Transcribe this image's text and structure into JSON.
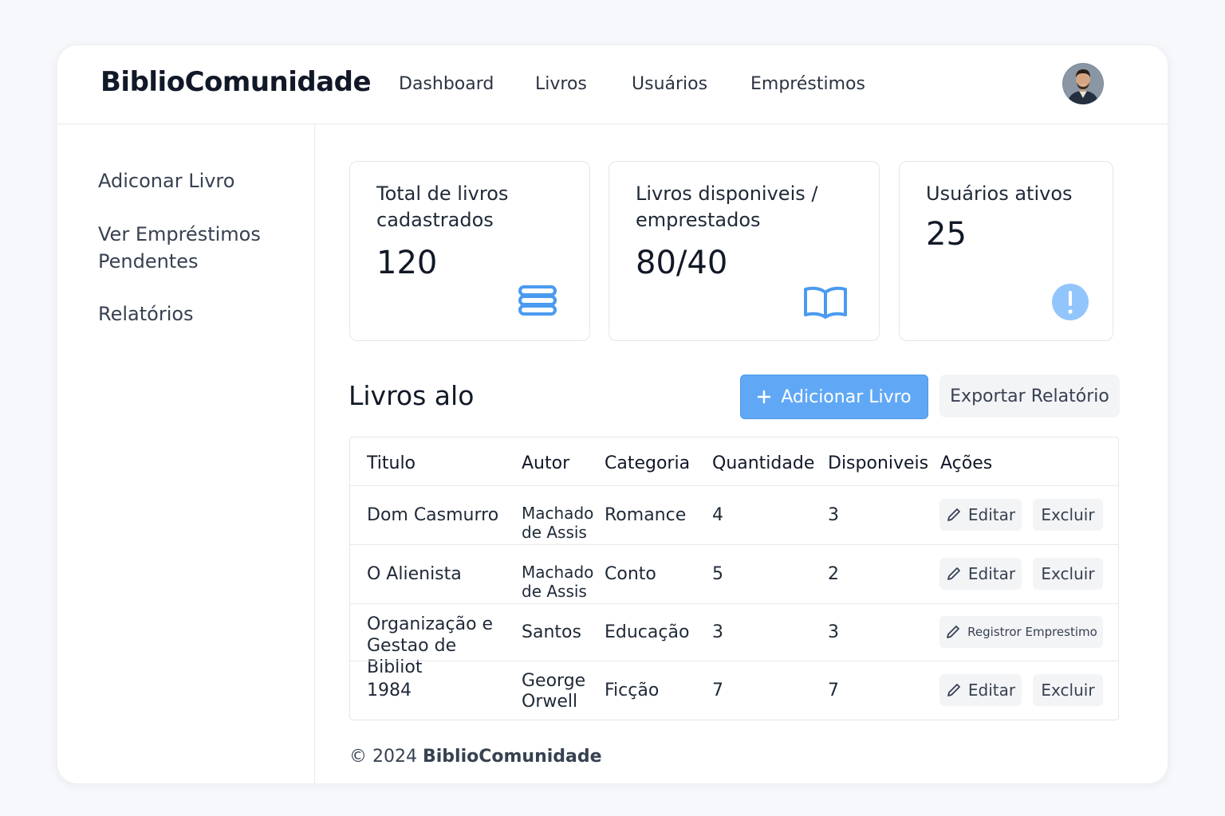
{
  "header": {
    "brand": "BiblioComunidade",
    "nav": [
      "Dashboard",
      "Livros",
      "Usuários",
      "Empréstimos"
    ]
  },
  "sidebar": {
    "items": [
      "Adiconar Livro",
      "Ver Empréstimos Pendentes",
      "Relatórios"
    ]
  },
  "stats": [
    {
      "title": "Total de livros cadastrados",
      "value": "120",
      "icon": "stack-icon"
    },
    {
      "title": "Livros disponiveis / emprestados",
      "value": "80/40",
      "icon": "open-book-icon"
    },
    {
      "title": "Usuários ativos",
      "value": "25",
      "icon": "alert-icon"
    }
  ],
  "section": {
    "title": "Livros alo",
    "add_label": "Adicionar Livro",
    "export_label": "Exportar Relatório"
  },
  "table": {
    "columns": [
      "Titulo",
      "Autor",
      "Categoria",
      "Quantidade",
      "Disponiveis",
      "Ações"
    ],
    "rows": [
      {
        "title": "Dom Casmurro",
        "author": "Machado de Assis",
        "category": "Romance",
        "quantity": "4",
        "available": "3",
        "actions": [
          "Editar",
          "Excluir"
        ]
      },
      {
        "title": "O Alienista",
        "author": "Machado de Assis",
        "category": "Conto",
        "quantity": "5",
        "available": "2",
        "actions": [
          "Editar",
          "Excluir"
        ]
      },
      {
        "title": "Organização e Gestao de Bibliot",
        "author": "Santos",
        "category": "Educação",
        "quantity": "3",
        "available": "3",
        "actions": [
          "Registror Emprestimo"
        ]
      },
      {
        "title": "1984",
        "author": "George Orwell",
        "category": "Ficção",
        "quantity": "7",
        "available": "7",
        "actions": [
          "Editar",
          "Excluir"
        ]
      }
    ]
  },
  "footer": {
    "copyright": "© 2024",
    "brand": "BiblioComunidade"
  },
  "colors": {
    "accent": "#60a8f5",
    "icon_blue": "#4a9bf0",
    "alert_fill": "#93c5fd"
  }
}
